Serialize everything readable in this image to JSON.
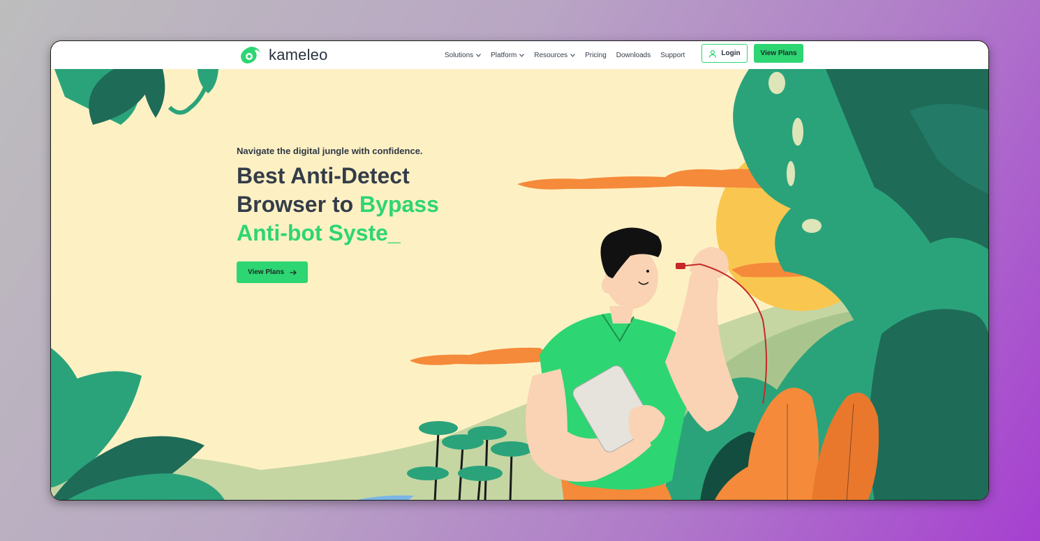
{
  "brand": {
    "name": "kameleo",
    "logo_icon": "chameleon-logo-icon",
    "accent": "#2ed573"
  },
  "nav": {
    "items": [
      {
        "label": "Solutions",
        "dropdown": true
      },
      {
        "label": "Platform",
        "dropdown": true
      },
      {
        "label": "Resources",
        "dropdown": true
      },
      {
        "label": "Pricing",
        "dropdown": false
      },
      {
        "label": "Downloads",
        "dropdown": false
      },
      {
        "label": "Support",
        "dropdown": false
      }
    ],
    "login_label": "Login",
    "login_icon": "user-icon",
    "view_plans_label": "View Plans"
  },
  "hero": {
    "tagline": "Navigate the digital jungle with confidence.",
    "headline_line1": "Best Anti-Detect",
    "headline_line2_plain": "Browser to ",
    "headline_line2_accent": "Bypass",
    "headline_line3_accent": "Anti-bot Syste_",
    "cta_label": "View Plans",
    "cta_icon": "arrow-right-icon"
  },
  "illustration": {
    "subject": "jungle-illustration",
    "colors": {
      "background": "#fdf1c4",
      "leaf": "#2ba37a",
      "leaf_dark": "#1e6b58",
      "sun": "#f9c74f",
      "cloud": "#f58a3a",
      "shirt": "#2ed573",
      "pants": "#f58a3a",
      "skin": "#f9d3b4",
      "hair": "#111111"
    }
  }
}
